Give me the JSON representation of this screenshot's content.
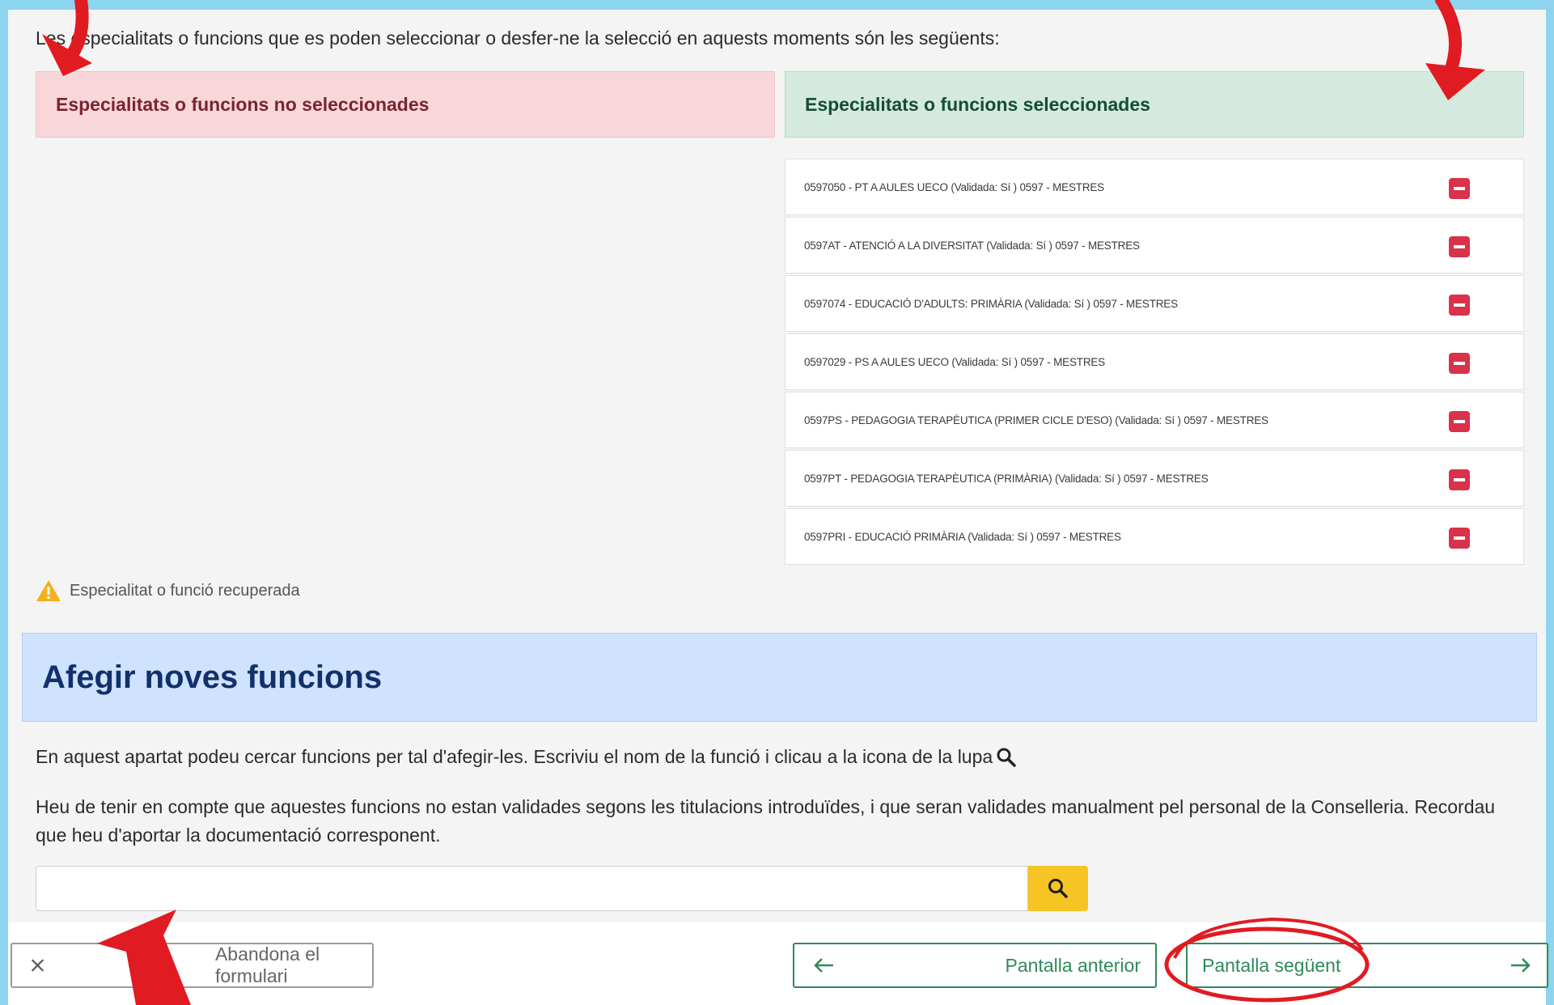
{
  "intro_text": "Les especialitats o funcions que es poden seleccionar o desfer-ne la selecció en aquests moments són les següents:",
  "unselected_header": "Especialitats o funcions no seleccionades",
  "selected_header": "Especialitats o funcions seleccionades",
  "selected_items": [
    {
      "label": "0597050 - PT A AULES UECO  (Validada: Sí ) 0597 - MESTRES"
    },
    {
      "label": "0597AT - ATENCIÓ A LA DIVERSITAT  (Validada: Sí ) 0597 - MESTRES"
    },
    {
      "label": "0597074 - EDUCACIÓ D'ADULTS: PRIMÀRIA  (Validada: Sí ) 0597 - MESTRES"
    },
    {
      "label": "0597029 - PS A AULES UECO  (Validada: Sí ) 0597 - MESTRES"
    },
    {
      "label": "0597PS - PEDAGOGIA TERAPÈUTICA (PRIMER CICLE D'ESO)  (Validada: Sí ) 0597 - MESTRES"
    },
    {
      "label": "0597PT - PEDAGOGIA TERAPÈUTICA (PRIMÀRIA)  (Validada: Sí ) 0597 - MESTRES"
    },
    {
      "label": "0597PRI - EDUCACIÓ PRIMÀRIA  (Validada: Sí ) 0597 - MESTRES"
    }
  ],
  "warning_label": "Especialitat o funció recuperada",
  "add_section_title": "Afegir noves funcions",
  "add_desc_1": "En aquest apartat podeu cercar funcions per tal d'afegir-les. Escriviu el nom de la funció i clicau a la icona de la lupa",
  "add_desc_2": "Heu de tenir en compte que aquestes funcions no estan validades segons les titulacions introduïdes, i que seran validades manualment pel personal de la Conselleria. Recordau que heu d'aportar la documentació corresponent.",
  "search_value": "",
  "cancel_label": "Abandona el formulari",
  "prev_label": "Pantalla anterior",
  "next_label": "Pantalla següent",
  "colors": {
    "border_frame": "#8dd4ef",
    "danger": "#d9324a",
    "success": "#2f8a59",
    "search_button": "#f6c423",
    "annotation_red": "#e11b22"
  },
  "icons": [
    "remove-icon",
    "warning-icon",
    "magnifier-icon",
    "search-icon",
    "close-icon",
    "arrow-left-icon",
    "arrow-right-icon"
  ]
}
